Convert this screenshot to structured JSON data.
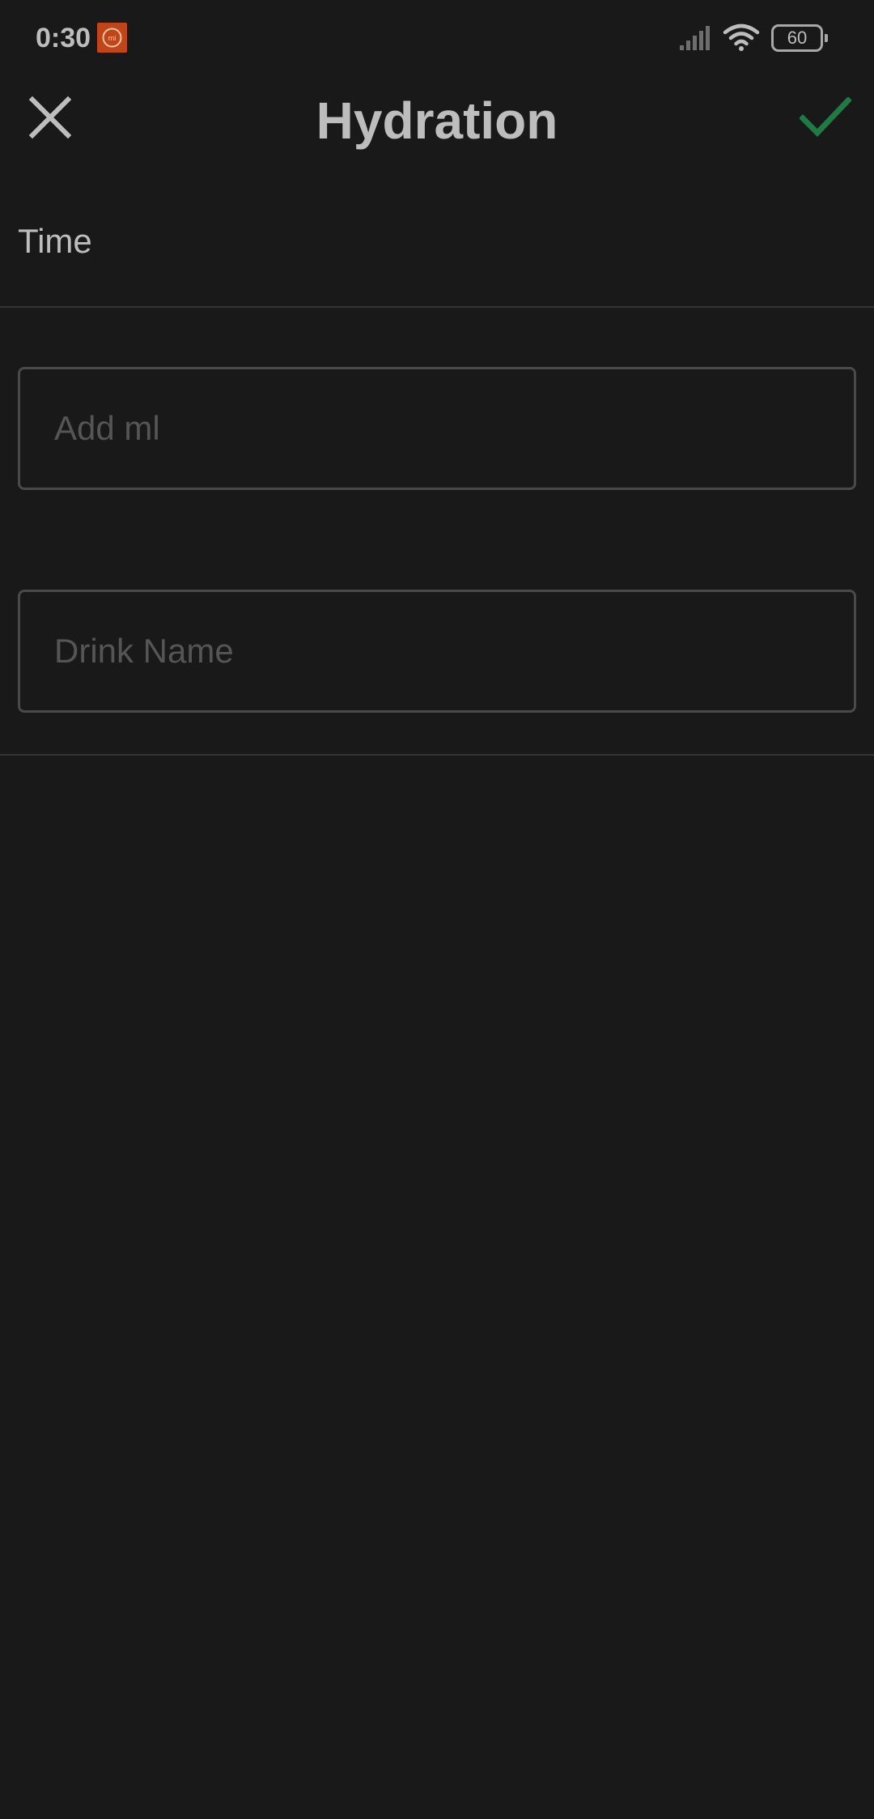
{
  "status_bar": {
    "time": "0:30",
    "notification_icon": "mi-fit-app-icon",
    "signal_icon": "cellular-signal-icon",
    "wifi_icon": "wifi-icon",
    "battery_level": "60"
  },
  "app_bar": {
    "title": "Hydration",
    "close_icon": "close-icon",
    "confirm_icon": "checkmark-icon"
  },
  "form": {
    "time_label": "Time",
    "amount_placeholder": "Add ml",
    "amount_value": "",
    "drink_name_placeholder": "Drink Name",
    "drink_name_value": ""
  },
  "colors": {
    "background": "#191919",
    "text": "#bdbdbd",
    "accent_confirm": "#1f7a44",
    "notification_badge": "#c0461a"
  }
}
